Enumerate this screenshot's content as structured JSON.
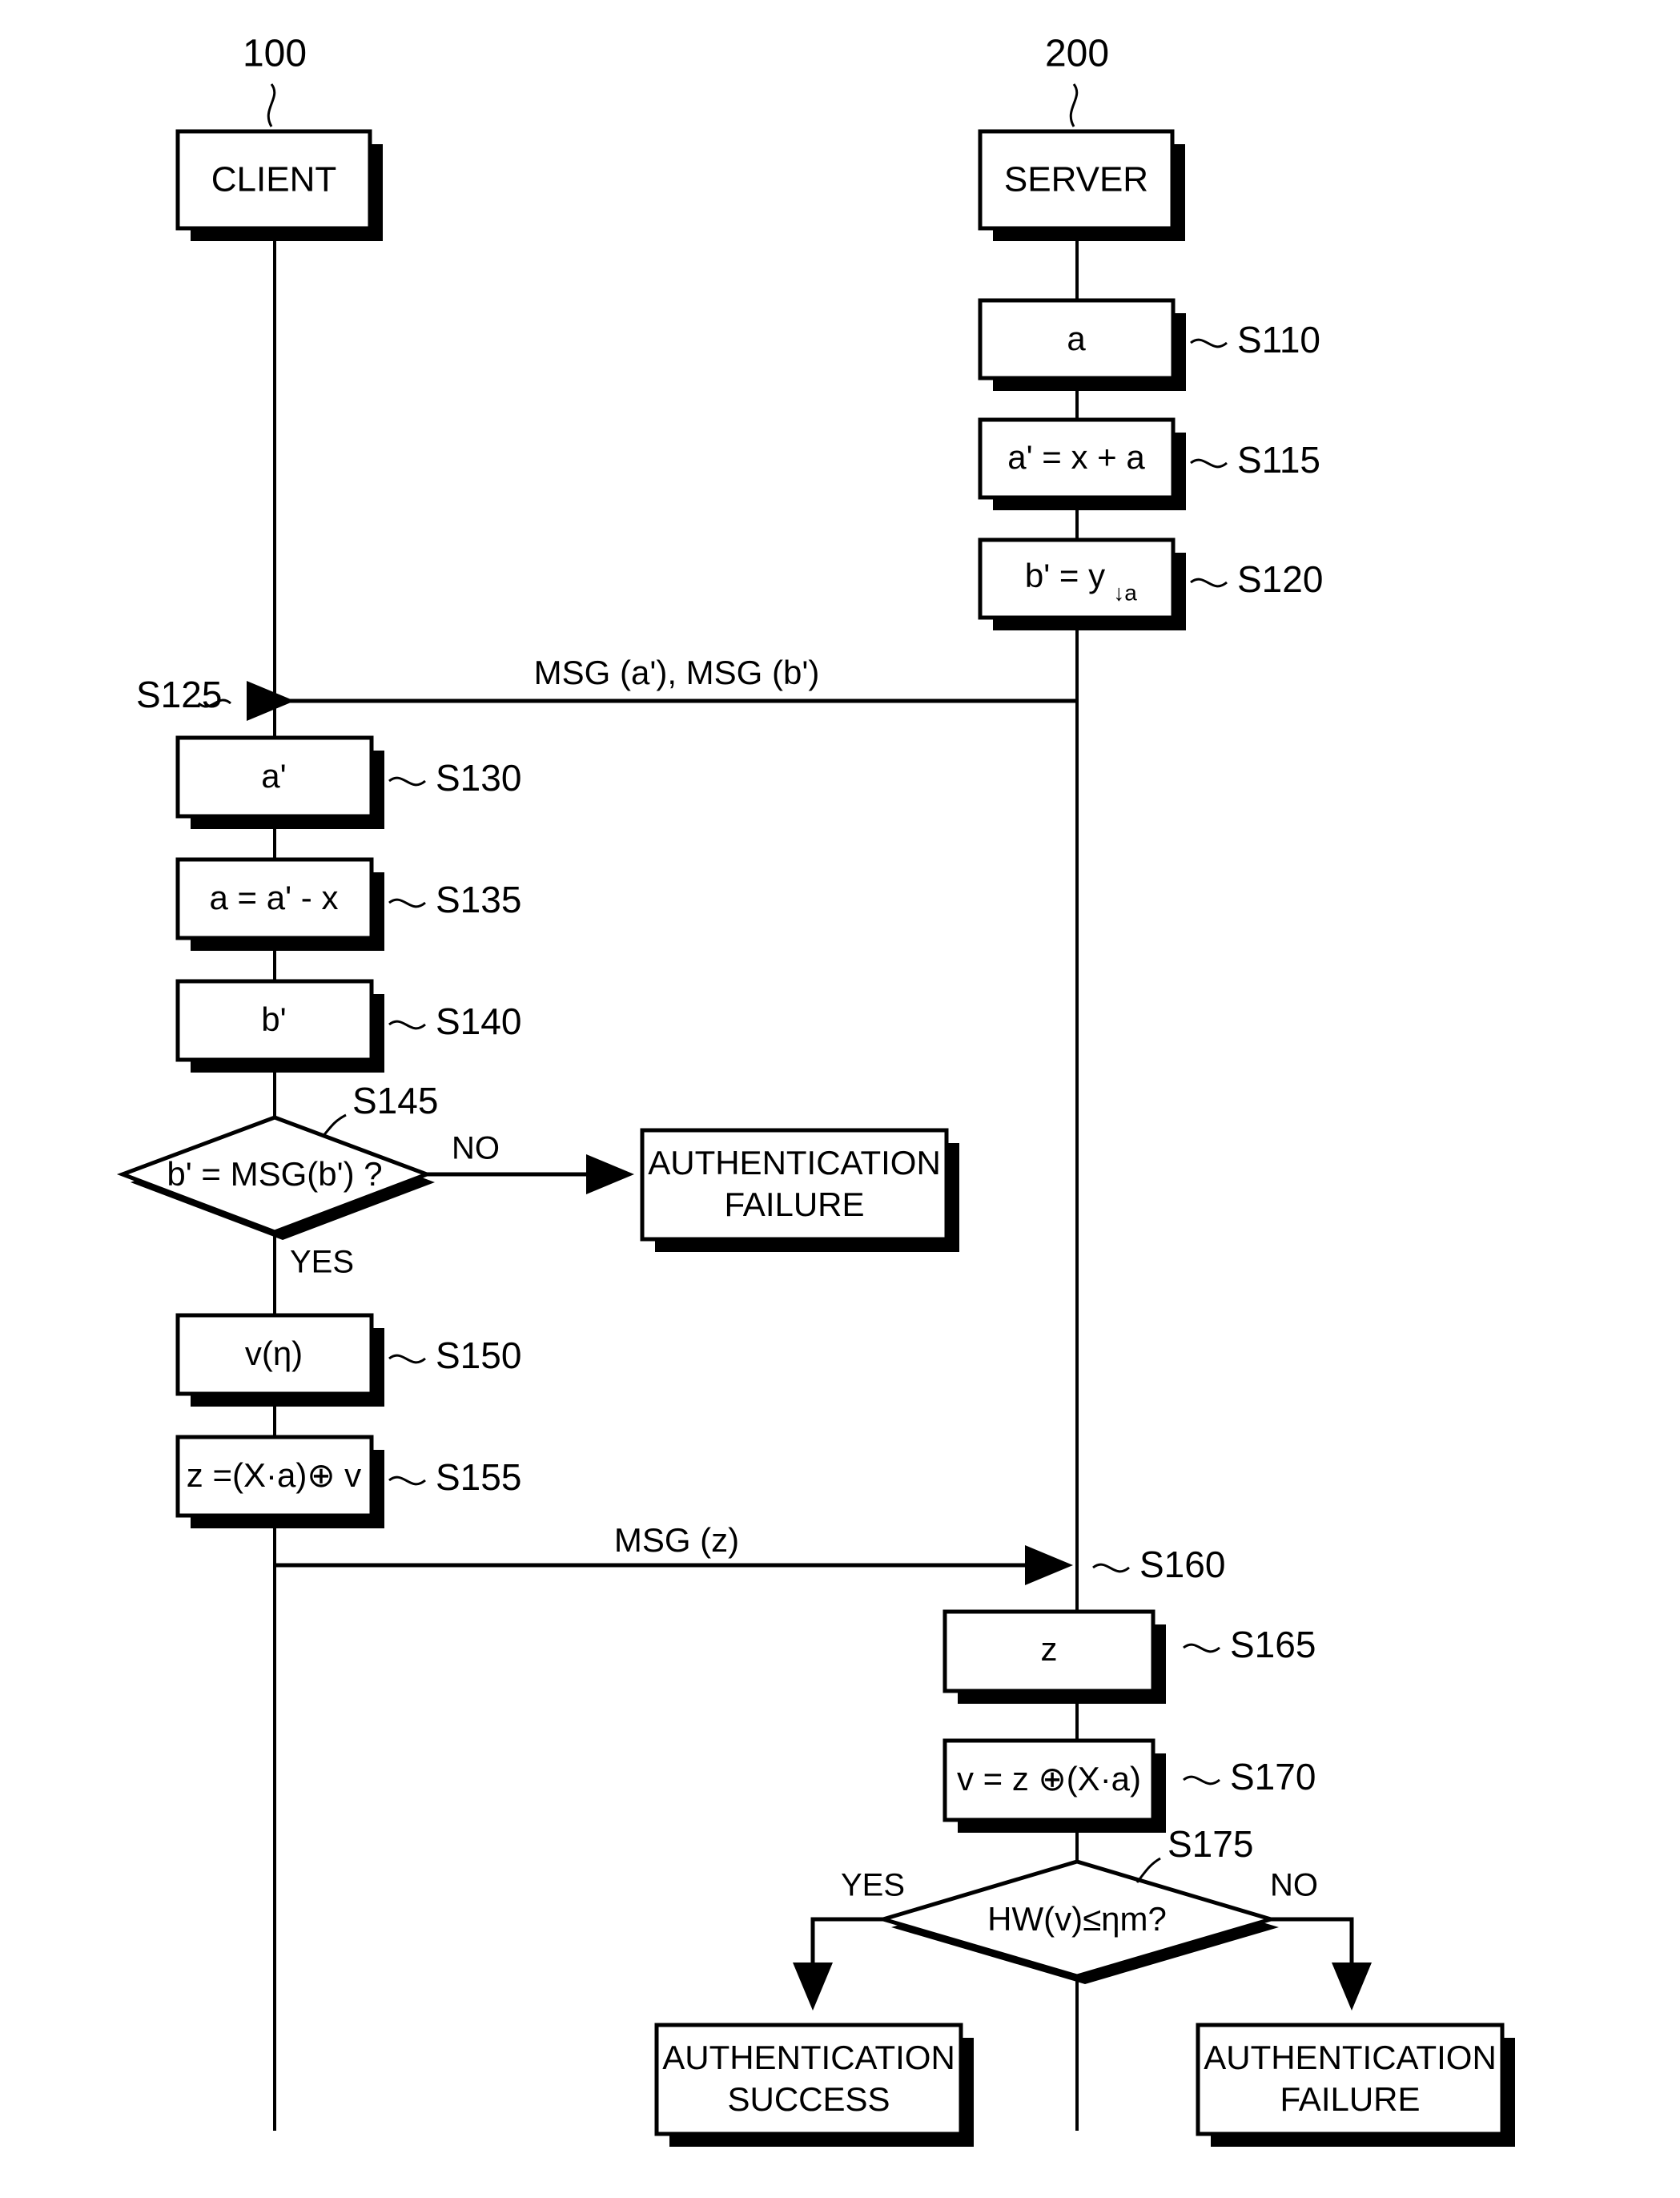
{
  "diagram": {
    "title": "Client-server authentication protocol sequence diagram",
    "colors": {
      "line": "#000000",
      "fill": "#ffffff",
      "shadow": "#000000"
    },
    "actors": [
      {
        "id": "client",
        "ref": "100",
        "label": "CLIENT"
      },
      {
        "id": "server",
        "ref": "200",
        "label": "SERVER"
      }
    ],
    "server_steps": [
      {
        "step": "S110",
        "text": "a"
      },
      {
        "step": "S115",
        "text": "a' = x + a"
      },
      {
        "step": "S120",
        "text": "b' = y",
        "subscript": "↓a"
      },
      {
        "step": "S165",
        "text": "z"
      },
      {
        "step": "S170",
        "text": "v = z ⊕(X·a)"
      }
    ],
    "client_steps": [
      {
        "step": "S130",
        "text": "a'"
      },
      {
        "step": "S135",
        "text": "a = a' - x"
      },
      {
        "step": "S140",
        "text": "b'"
      },
      {
        "step": "S150",
        "text": "v(η)"
      },
      {
        "step": "S155",
        "text": "z =(X·a)⊕ v"
      }
    ],
    "messages": [
      {
        "step": "S125",
        "label": "MSG (a'), MSG (b')",
        "direction": "server-to-client"
      },
      {
        "step": "S160",
        "label": "MSG (z)",
        "direction": "client-to-server"
      }
    ],
    "decisions": [
      {
        "step": "S145",
        "text": "b' = MSG(b') ?",
        "branch_yes": "YES",
        "branch_no": "NO",
        "owner": "client"
      },
      {
        "step": "S175",
        "text": "HW(v)≤ηm?",
        "branch_yes": "YES",
        "branch_no": "NO",
        "owner": "server"
      }
    ],
    "outcomes": [
      {
        "id": "client-failure",
        "line1": "AUTHENTICATION",
        "line2": "FAILURE"
      },
      {
        "id": "server-success",
        "line1": "AUTHENTICATION",
        "line2": "SUCCESS"
      },
      {
        "id": "server-failure",
        "line1": "AUTHENTICATION",
        "line2": "FAILURE"
      }
    ]
  }
}
